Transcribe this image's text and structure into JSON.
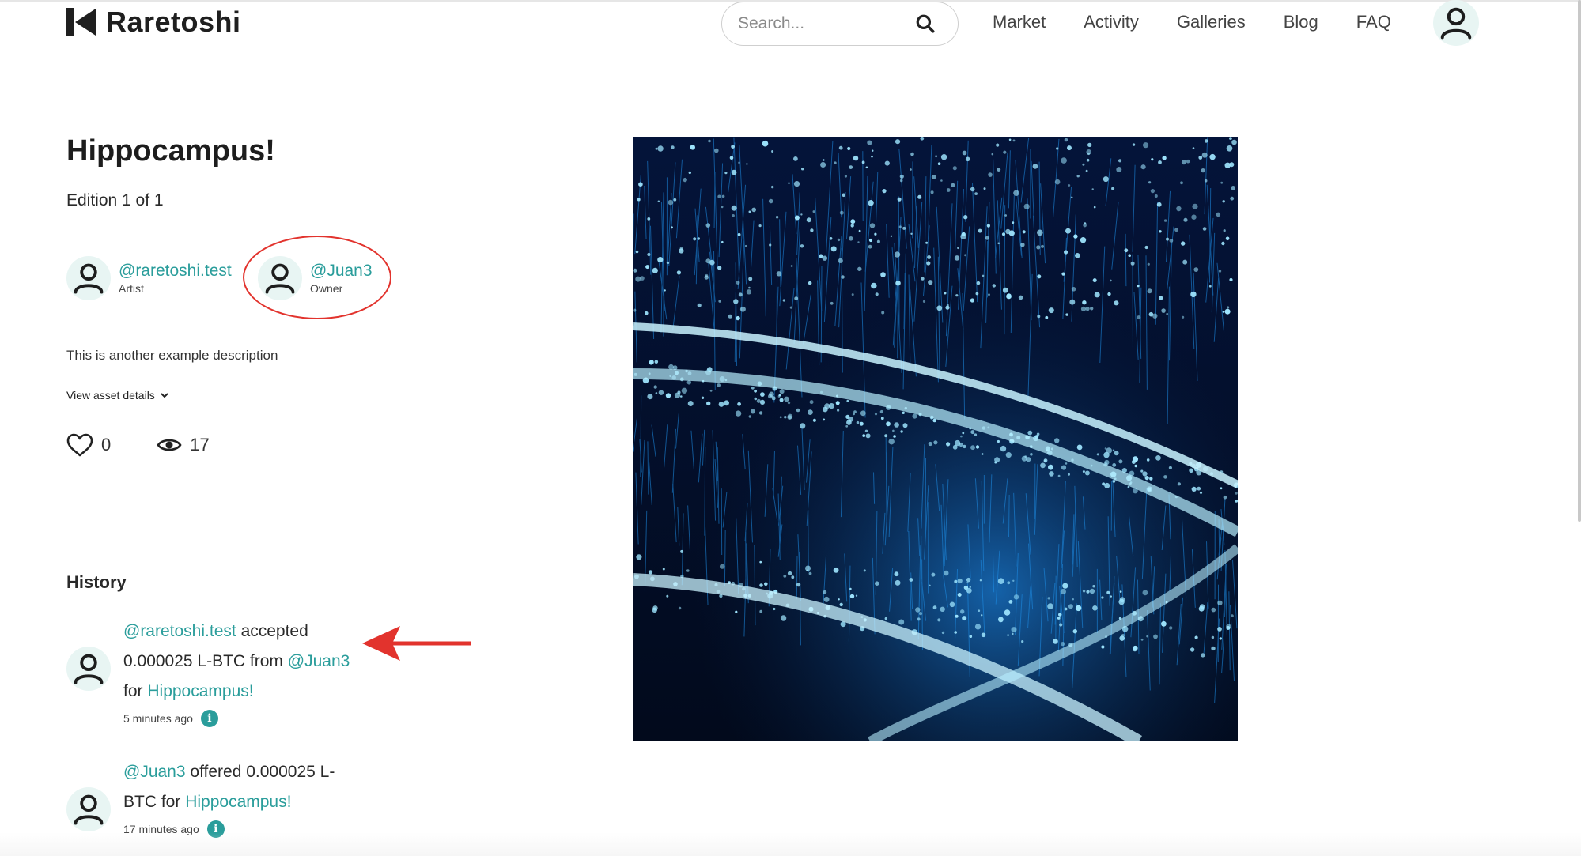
{
  "brand": {
    "name": "Raretoshi"
  },
  "search": {
    "placeholder": "Search..."
  },
  "nav": {
    "items": [
      "Market",
      "Activity",
      "Galleries",
      "Blog",
      "FAQ"
    ]
  },
  "asset": {
    "title": "Hippocampus!",
    "edition": "Edition 1 of 1",
    "artist": {
      "handle": "@raretoshi.test",
      "role": "Artist"
    },
    "owner": {
      "handle": "@Juan3",
      "role": "Owner"
    },
    "description": "This is another example description",
    "view_details_label": "View asset details",
    "likes": "0",
    "views": "17"
  },
  "history": {
    "title": "History",
    "items": [
      {
        "actor": "@raretoshi.test",
        "action": "accepted",
        "amount_text": "0.000025 L-BTC from",
        "counterparty": "@Juan3",
        "for_word": "for",
        "asset": "Hippocampus!",
        "time": "5 minutes ago"
      },
      {
        "actor": "@Juan3",
        "action": "offered 0.000025 L-BTC",
        "for_word": "for",
        "asset": "Hippocampus!",
        "time": "17 minutes ago"
      }
    ]
  },
  "colors": {
    "accent": "#2a9d9b",
    "annotation": "#e2332d",
    "artwork_bg": "#020a1c"
  }
}
